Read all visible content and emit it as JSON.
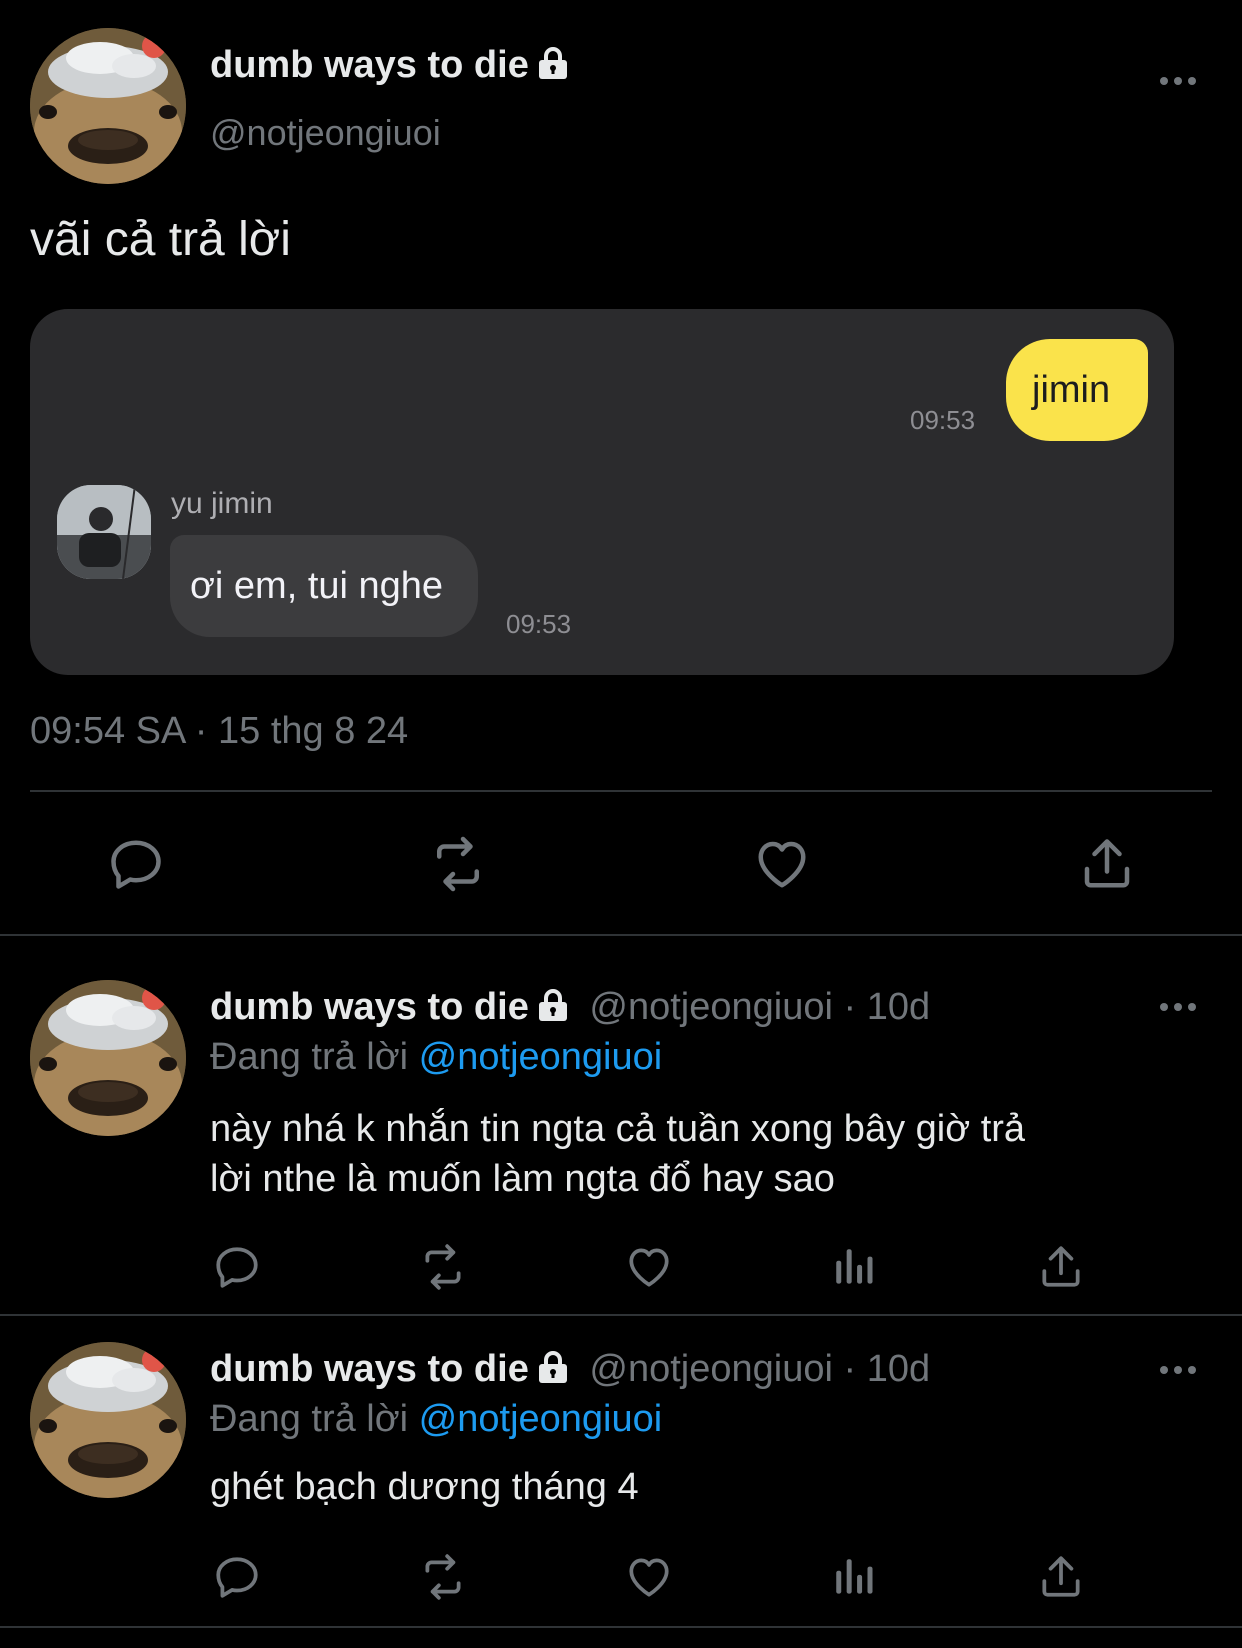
{
  "main_tweet": {
    "display_name": "dumb ways to die",
    "handle": "@notjeongiuoi",
    "text": "vãi cả trả lời",
    "timestamp": "09:54 SA · 15 thg 8 24",
    "chat": {
      "sent_message": "jimin",
      "sent_time": "09:53",
      "contact_name": "yu jimin",
      "received_message": "ơi em, tui nghe",
      "received_time": "09:53"
    }
  },
  "replies": [
    {
      "display_name": "dumb ways to die",
      "handle": "@notjeongiuoi",
      "age": "· 10d",
      "replying_label": "Đang trả lời",
      "replying_to": "@notjeongiuoi",
      "text_line1": "này nhá k nhắn tin ngta cả tuần xong bây giờ trả",
      "text_line2": "lời nthe là muốn làm ngta đổ hay sao"
    },
    {
      "display_name": "dumb ways to die",
      "handle": "@notjeongiuoi",
      "age": "· 10d",
      "replying_label": "Đang trả lời",
      "replying_to": "@notjeongiuoi",
      "text_line1": "ghét bạch dương tháng 4"
    }
  ],
  "icons": [
    "lock-icon",
    "more-icon",
    "reply-icon",
    "retweet-icon",
    "like-icon",
    "views-icon",
    "share-icon"
  ],
  "colors": {
    "background": "#000000",
    "text": "#e7e9ea",
    "secondary": "#71767b",
    "link": "#1d9bf0",
    "chat_card": "#2b2b2d",
    "sent_bubble": "#fae34b",
    "received_bubble": "#3c3c3e"
  }
}
